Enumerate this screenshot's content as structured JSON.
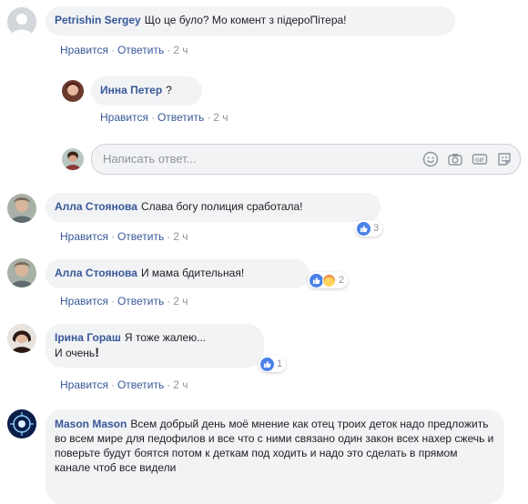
{
  "comments": [
    {
      "author": "Petrishin Sergey",
      "text": "Що це було? Мо комент з підероПітера!",
      "like": "Нравится",
      "reply": "Ответить",
      "time": "2 ч"
    },
    {
      "author": "Инна Петер",
      "text": "?",
      "like": "Нравится",
      "reply": "Ответить",
      "time": "2 ч"
    },
    {
      "author": "Алла Стоянова",
      "text": "Слава богу полиция сработала!",
      "like": "Нравится",
      "reply": "Ответить",
      "time": "2 ч",
      "reactions": "3"
    },
    {
      "author": "Алла Стоянова",
      "text": "И мама бдительная!",
      "like": "Нравится",
      "reply": "Ответить",
      "time": "2 ч",
      "reactions": "2"
    },
    {
      "author": "Ірина Гораш",
      "text_line1": "Я тоже жалею...",
      "text_line2": "И очень",
      "text_line2_bold": "!",
      "like": "Нравится",
      "reply": "Ответить",
      "time": "2 ч",
      "reactions": "1"
    },
    {
      "author": "Mason Mason",
      "text": "Всем добрый день моё мнение как отец троих деток надо предложить во всем мире для педофилов и все что с ними связано один закон всех нахер сжечь и поверьте будут боятся потом к деткам под ходить и надо это сделать в прямом канале чтоб все видели"
    }
  ],
  "reply_box": {
    "placeholder": "Написать ответ..."
  },
  "separator": "·",
  "icons": [
    "emoji-icon",
    "camera-icon",
    "gif-icon",
    "sticker-icon",
    "like-icon",
    "angry-icon"
  ],
  "colors": {
    "link": "#385898",
    "meta": "#90949c",
    "bubble": "#f2f3f5",
    "like": "#4a81e8"
  }
}
